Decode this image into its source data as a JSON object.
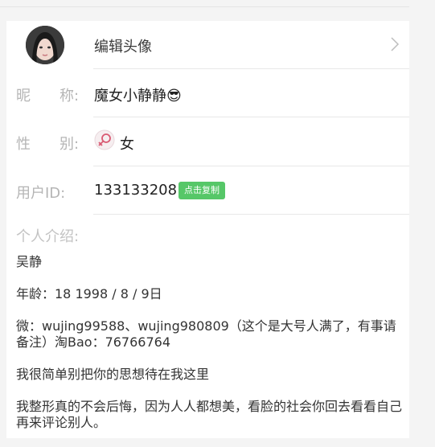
{
  "avatar_row": {
    "label": "编辑头像"
  },
  "nickname": {
    "label": "昵　　称:",
    "value": "魔女小静静😎"
  },
  "gender": {
    "label": "性　　别:",
    "value": "女",
    "icon": "female-icon"
  },
  "user_id": {
    "label": "用户ID:",
    "value": "133133208",
    "copy_label": "点击复制"
  },
  "intro": {
    "label": "个人介绍:",
    "lines": [
      "吴静",
      "年龄：18 1998 / 8 / 9日",
      "微：wujing99588、wujing980809（这个是大号人满了，有事请备注）淘Bao：76766764",
      "我很简单别把你的思想待在我这里",
      "我整形真的不会后悔，因为人人都想美，看脸的社会你回去看看自己再来评论别人。"
    ]
  },
  "colors": {
    "copy_button": "#56c768",
    "label": "#b5b5b5",
    "background": "#f4f4f4"
  }
}
